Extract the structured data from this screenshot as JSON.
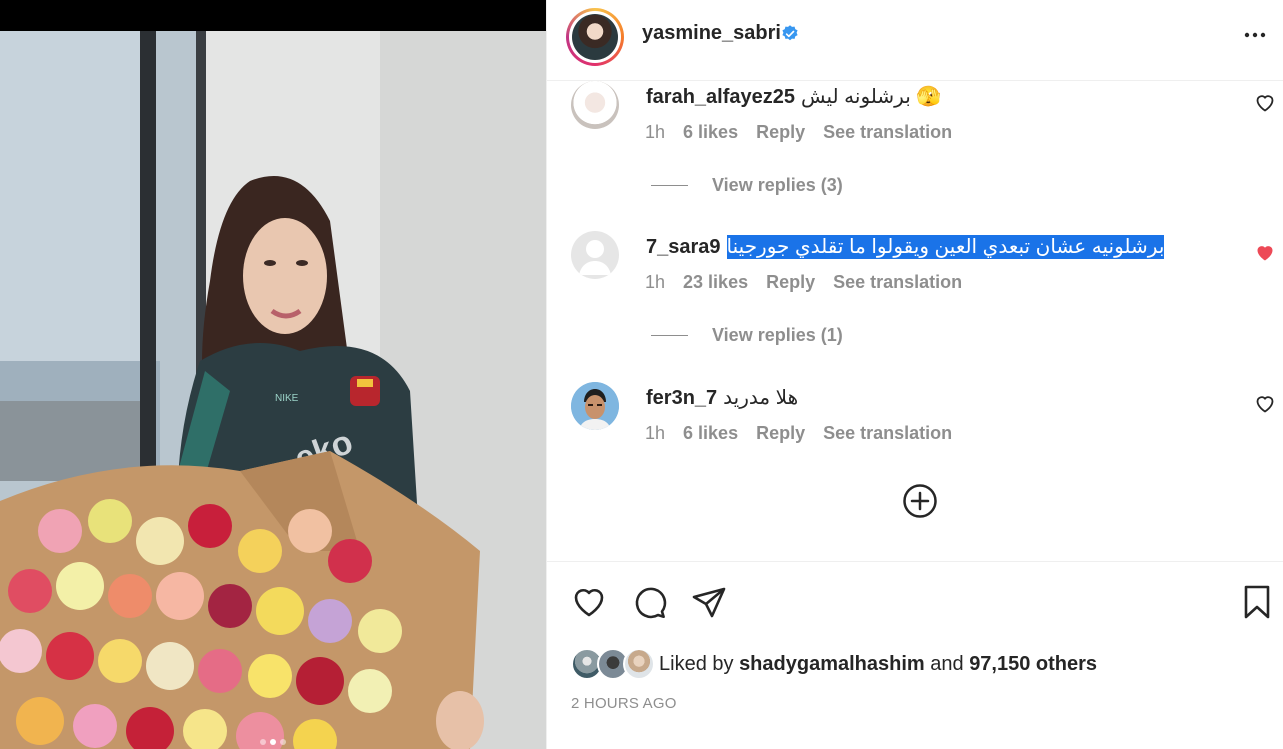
{
  "post": {
    "username": "yasmine_sabri",
    "verified": true,
    "more_icon": "more-horizontal-icon",
    "photo_alt": "woman in barcelona jacket holding bouquet of roses"
  },
  "comments": [
    {
      "username": "farah_alfayez25",
      "text": "برشلونه ليش 🫣",
      "time": "1h",
      "likes": "6 likes",
      "reply": "Reply",
      "translate": "See translation",
      "liked": false,
      "view_replies": "View replies (3)"
    },
    {
      "username": "7_sara9",
      "text": "برشلونيه عشان تبعدي العين ويقولوا ما تقلدي جورجينا",
      "time": "1h",
      "likes": "23 likes",
      "reply": "Reply",
      "translate": "See translation",
      "liked": true,
      "view_replies": "View replies (1)"
    },
    {
      "username": "fer3n_7",
      "text": "هلا مدريد",
      "time": "1h",
      "likes": "6 likes",
      "reply": "Reply",
      "translate": "See translation",
      "liked": false
    }
  ],
  "actions": {
    "liked_by_prefix": "Liked by",
    "liked_by_user": "shadygamalhashim",
    "liked_by_and": "and",
    "liked_by_others": "97,150 others",
    "timestamp": "2 HOURS AGO"
  },
  "colors": {
    "text": "#262626",
    "muted": "#8e8e8e",
    "like_red": "#ed4956",
    "verified_blue": "#3897f0",
    "selection": "#1a73e8"
  }
}
